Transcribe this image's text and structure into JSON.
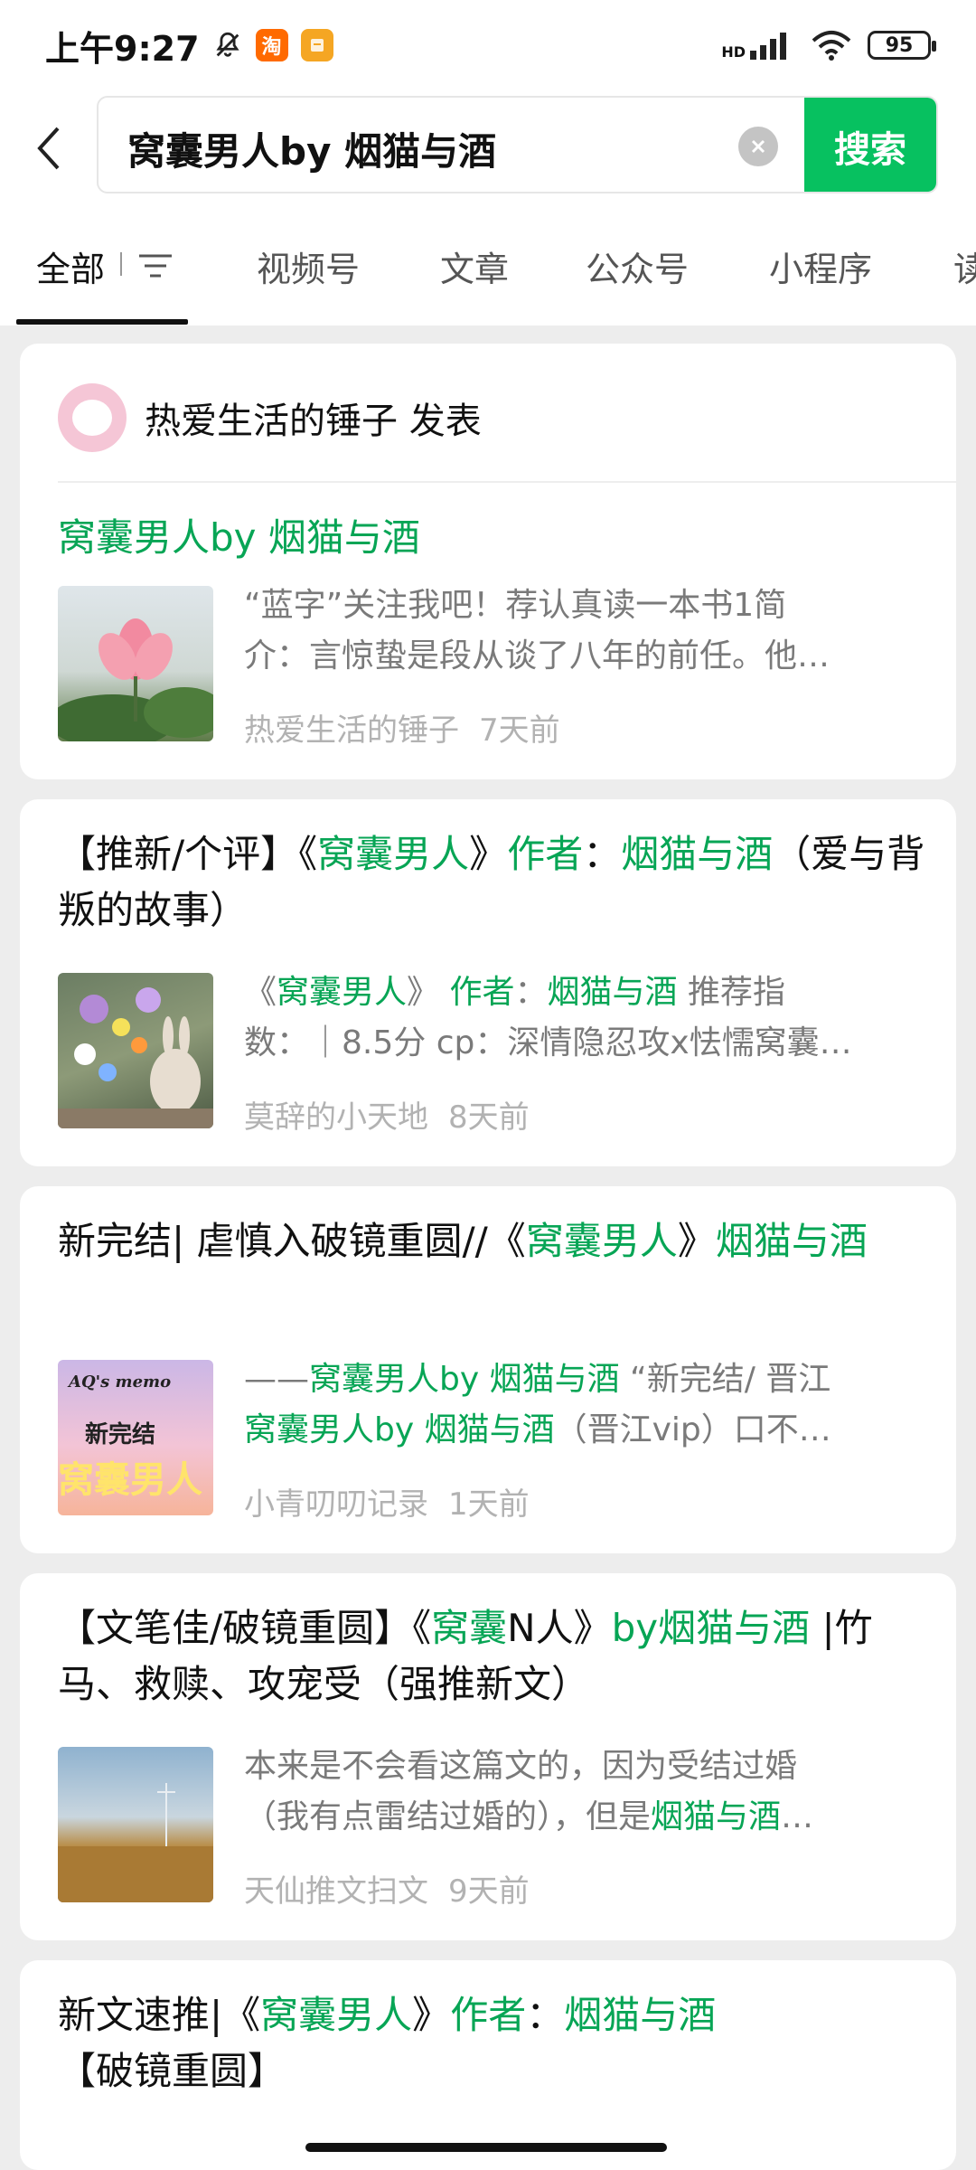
{
  "status_bar": {
    "time": "上午9:27",
    "app_icon_1": "淘",
    "network": "HD",
    "battery": "95"
  },
  "search": {
    "query": "窝囊男人by 烟猫与酒",
    "button_label": "搜索",
    "icons": {
      "back": "chevron-left-icon",
      "clear": "clear-icon"
    }
  },
  "tabs": [
    {
      "label": "全部",
      "active": true
    },
    {
      "label": "视频号"
    },
    {
      "label": "文章"
    },
    {
      "label": "公众号"
    },
    {
      "label": "小程序"
    },
    {
      "label": "读"
    }
  ],
  "colors": {
    "accent": "#07c160",
    "highlight": "#07a555",
    "meta": "#b2b2b2"
  },
  "results": [
    {
      "author_header": "热爱生活的锤子 发表",
      "title_parts": [
        {
          "t": "窝囊男人by 烟猫与酒",
          "h": true
        }
      ],
      "snippet_lines": [
        [
          {
            "t": "“蓝字”关注我吧！荐认真读一本书1简"
          }
        ],
        [
          {
            "t": "介：言惊蛰是段从谈了八年的前任。他…"
          }
        ]
      ],
      "source": "热爱生活的锤子",
      "time": "7天前",
      "thumb": "lotus-photo"
    },
    {
      "title_parts": [
        {
          "t": "【推新/个评】《"
        },
        {
          "t": "窝囊男人",
          "h": true
        },
        {
          "t": "》"
        },
        {
          "t": "作者",
          "h": true
        },
        {
          "t": "："
        },
        {
          "t": "烟猫与酒",
          "h": true
        },
        {
          "t": "（爱与背叛的故事）"
        }
      ],
      "snippet_lines": [
        [
          {
            "t": "《"
          },
          {
            "t": "窝囊男人",
            "h": true
          },
          {
            "t": "》 "
          },
          {
            "t": "作者",
            "h": true
          },
          {
            "t": "："
          },
          {
            "t": "烟猫与酒",
            "h": true
          },
          {
            "t": " 推荐指"
          }
        ],
        [
          {
            "t": "数：｜8.5分 cp：深情隐忍攻x怯懦窝囊…"
          }
        ]
      ],
      "source": "莫辞的小天地",
      "time": "8天前",
      "thumb": "flowers-bunny-photo"
    },
    {
      "title_parts": [
        {
          "t": "新完结| 虐慎入破镜重圆//《"
        },
        {
          "t": "窝囊男人",
          "h": true
        },
        {
          "t": "》"
        },
        {
          "t": "烟猫与酒",
          "h": true
        }
      ],
      "snippet_lines": [
        [
          {
            "t": "——"
          },
          {
            "t": "窝囊男人by 烟猫与酒",
            "h": true
          },
          {
            "t": " “新完结/ 晋江"
          }
        ],
        [
          {
            "t": "窝囊男人by 烟猫与酒",
            "h": true
          },
          {
            "t": "（晋江vip）口不…"
          }
        ]
      ],
      "source": "小青叨叨记录",
      "time": "1天前",
      "thumb": "memo-cover",
      "thumb_text": {
        "top": "AQ's memo",
        "mid": "新完结",
        "big": "窝囊男人"
      }
    },
    {
      "title_parts": [
        {
          "t": "【文笔佳/破镜重圆】《"
        },
        {
          "t": "窝囊",
          "h": true
        },
        {
          "t": "N人》"
        },
        {
          "t": "by烟猫与酒",
          "h": true
        },
        {
          "t": " |竹马、救赎、攻宠受（强推新文）"
        }
      ],
      "snippet_lines": [
        [
          {
            "t": "本来是不会看这篇文的，因为受结过婚"
          }
        ],
        [
          {
            "t": "（我有点雷结过婚的），但是"
          },
          {
            "t": "烟猫与酒",
            "h": true
          },
          {
            "t": "…"
          }
        ]
      ],
      "source": "天仙推文扫文",
      "time": "9天前",
      "thumb": "wheat-field-photo"
    },
    {
      "title_parts": [
        {
          "t": "新文速推|《"
        },
        {
          "t": "窝囊男人",
          "h": true
        },
        {
          "t": "》"
        },
        {
          "t": "作者",
          "h": true
        },
        {
          "t": "："
        },
        {
          "t": "烟猫与酒",
          "h": true
        },
        {
          "t": "【破镜重圆】"
        }
      ]
    }
  ]
}
